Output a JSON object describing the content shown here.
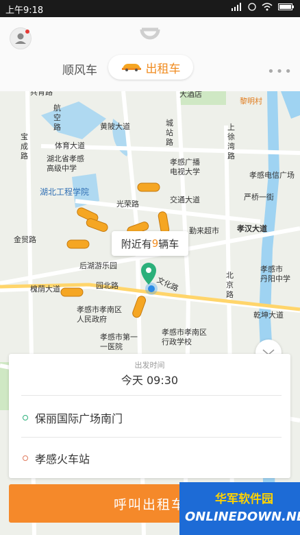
{
  "status_bar": {
    "time": "上午9:18"
  },
  "header": {
    "tabs": [
      {
        "label": "顺风车",
        "selected": false
      },
      {
        "label": "出租车",
        "selected": true
      }
    ],
    "more_icon": "more-dots-icon"
  },
  "map": {
    "nearby_prefix": "附近有",
    "nearby_count": "9",
    "nearby_suffix": "辆车",
    "taxi_count_shown": 9,
    "labels": {
      "yuqing": "兵育路",
      "dajiudian": "大酒店",
      "limingcun": "黎明村",
      "hangkonglu": "航\n空\n路",
      "huangpidadao": "黄陂大道",
      "chengzhanlu": "城\n站\n路",
      "shangxuwanlu": "上\n徐\n湾\n路",
      "baochenglu": "宝\n成\n路",
      "tiyudadao": "体育大道",
      "hbxgzx": "湖北省孝感\n高级中学",
      "xgguangbo": "孝感广播\n电视大学",
      "xgdianxin": "孝感电信广场",
      "hbgcxy": "湖北工程学院",
      "guangronglu": "光荣路",
      "jiaotongdadao": "交通大道",
      "yanqiaoyijie": "严桥一街",
      "qinlaichaoshi": "勤来超市",
      "xiaohandadao": "孝汉大道",
      "jinmaolu": "金贸路",
      "houhuyoule": "后湖游乐园",
      "yuanbeilu": "园北路",
      "wenhualu": "文化路",
      "beijinglu": "北\n京\n路",
      "xgdanyang": "孝感市\n丹阳中学",
      "huaiyindadao": "槐荫大道",
      "xgxnqzf": "孝感市孝南区\n人民政府",
      "qianweidadao": "乾坤大道",
      "xgdiyiyiyuan": "孝感市第一\n一医院",
      "xgxnqxzxx": "孝感市孝南区\n行政学校"
    }
  },
  "trip_card": {
    "departure_label": "出发时间",
    "departure_value": "今天 09:30",
    "start_location": "保丽国际广场南门",
    "end_location": "孝感火车站"
  },
  "call_button": {
    "label": "呼叫出租车"
  },
  "watermark": {
    "cn": "华军软件园",
    "en": "ONLINEDOWN.NET"
  },
  "colors": {
    "accent": "#f5892a",
    "start_dot": "#2bb07a",
    "end_dot": "#e0795c"
  }
}
